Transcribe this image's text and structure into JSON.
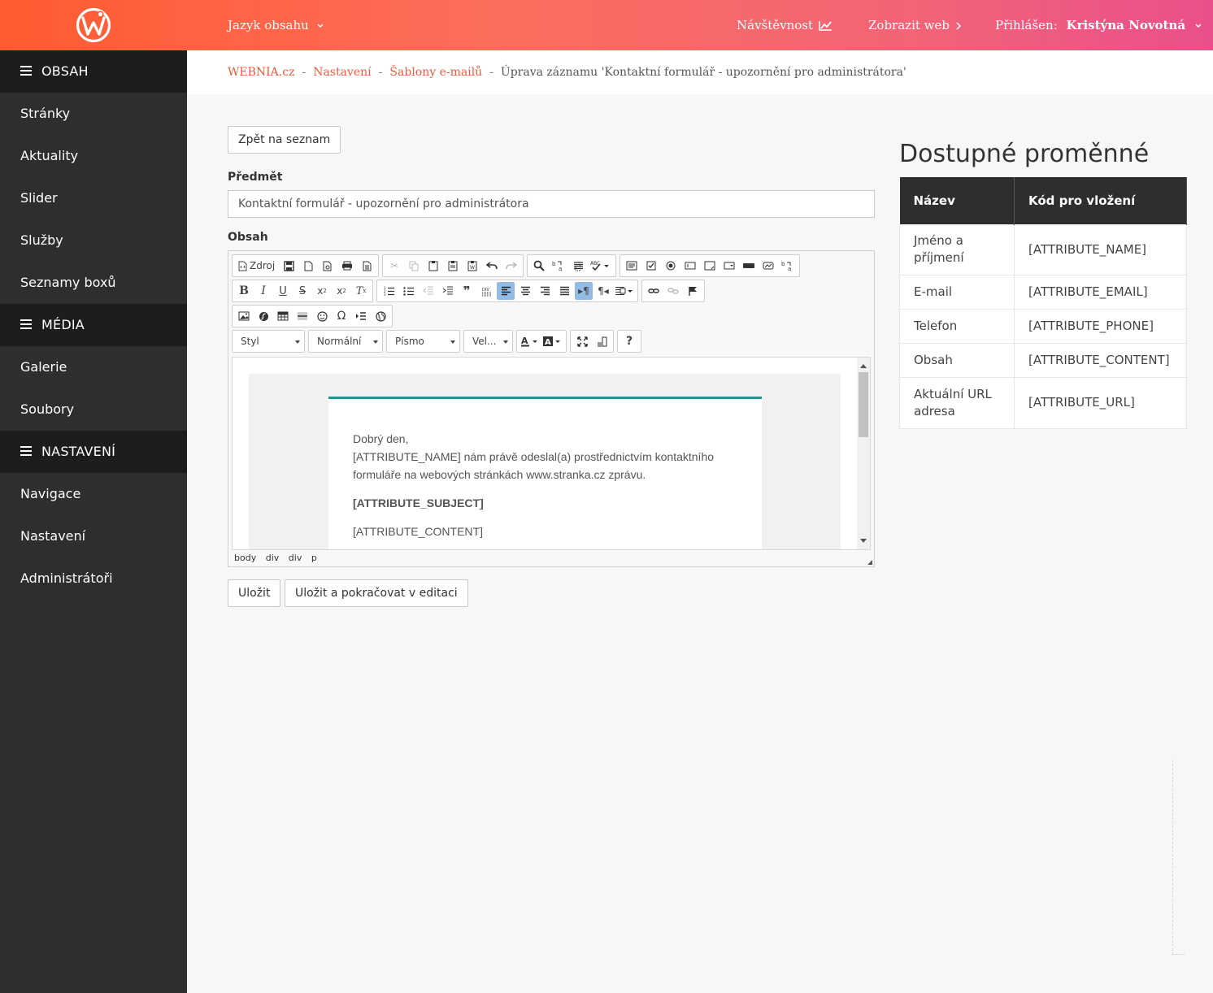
{
  "colors": {
    "accent": "#f05a3c",
    "sidebar": "#2e2e2e",
    "sidebar_section": "#1d1d1d",
    "editor_rule": "#22958f"
  },
  "topbar": {
    "content_language": "Jazyk obsahu",
    "traffic": "Návštěvnost",
    "view_web": "Zobrazit web",
    "logged_in_label": "Přihlášen:",
    "user_name": "Kristýna Novotná"
  },
  "sidebar": {
    "sections": [
      {
        "label": "OBSAH",
        "items": [
          "Stránky",
          "Aktuality",
          "Slider",
          "Služby",
          "Seznamy boxů"
        ]
      },
      {
        "label": "MÉDIA",
        "items": [
          "Galerie",
          "Soubory"
        ]
      },
      {
        "label": "NASTAVENÍ",
        "items": [
          "Navigace",
          "Nastavení",
          "Administrátoři"
        ]
      }
    ]
  },
  "breadcrumb": {
    "home": "WEBNIA.cz",
    "settings": "Nastavení",
    "templates": "Šablony e-mailů",
    "current": "Úprava záznamu 'Kontaktní formulář - upozornění pro administrátora'",
    "separator": "-"
  },
  "form": {
    "back_button": "Zpět na seznam",
    "subject_label": "Předmět",
    "subject_value": "Kontaktní formulář - upozornění pro administrátora",
    "content_label": "Obsah",
    "save_button": "Uložit",
    "save_continue_button": "Uložit a pokračovat v editaci"
  },
  "editor": {
    "source_button": "Zdroj",
    "combo_style": "Styl",
    "combo_format": "Normální",
    "combo_font": "Písmo",
    "combo_size": "Vel...",
    "help": "?",
    "email_lines": {
      "greeting": "Dobrý den,",
      "body": "[ATTRIBUTE_NAME] nám právě odeslal(a) prostřednictvím kontaktního formuláře na webových stránkách www.stranka.cz zprávu.",
      "subject": "[ATTRIBUTE_SUBJECT]",
      "content": "[ATTRIBUTE_CONTENT]"
    },
    "element_path": [
      "body",
      "div",
      "div",
      "p"
    ]
  },
  "variables": {
    "title": "Dostupné proměnné",
    "headers": [
      "Název",
      "Kód pro vložení"
    ],
    "rows": [
      [
        "Jméno a příjmení",
        "[ATTRIBUTE_NAME]"
      ],
      [
        "E-mail",
        "[ATTRIBUTE_EMAIL]"
      ],
      [
        "Telefon",
        "[ATTRIBUTE_PHONE]"
      ],
      [
        "Obsah",
        "[ATTRIBUTE_CONTENT]"
      ],
      [
        "Aktuální URL adresa",
        "[ATTRIBUTE_URL]"
      ]
    ]
  }
}
